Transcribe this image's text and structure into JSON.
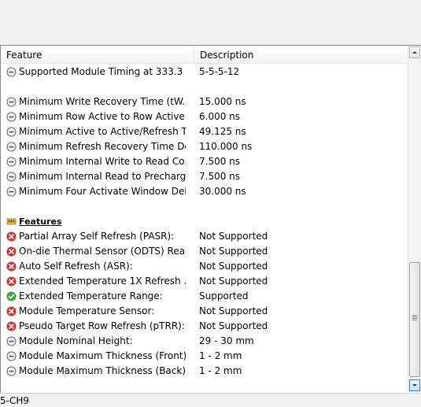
{
  "table": {
    "col_feature": "Feature",
    "col_description": "Description"
  },
  "rows": [
    {
      "icon": "info",
      "feature": "Supported Module Timing at 333.3 ...",
      "value": "5-5-5-12"
    },
    {
      "icon": "blank",
      "feature": "",
      "value": ""
    },
    {
      "icon": "info",
      "feature": "Minimum Write Recovery Time (tW...",
      "value": "15.000 ns"
    },
    {
      "icon": "info",
      "feature": "Minimum Row Active to Row Active...",
      "value": "6.000 ns"
    },
    {
      "icon": "info",
      "feature": "Minimum Active to Active/Refresh T...",
      "value": "49.125 ns"
    },
    {
      "icon": "info",
      "feature": "Minimum Refresh Recovery Time De...",
      "value": "110.000 ns"
    },
    {
      "icon": "info",
      "feature": "Minimum Internal Write to Read Co...",
      "value": "7.500 ns"
    },
    {
      "icon": "info",
      "feature": "Minimum Internal Read to Precharg...",
      "value": "7.500 ns"
    },
    {
      "icon": "info",
      "feature": "Minimum Four Activate Window Del...",
      "value": "30.000 ns"
    },
    {
      "icon": "blank",
      "feature": "",
      "value": ""
    },
    {
      "icon": "section",
      "feature": "Features",
      "value": ""
    },
    {
      "icon": "error",
      "feature": "Partial Array Self Refresh (PASR):",
      "value": "Not Supported"
    },
    {
      "icon": "error",
      "feature": "On-die Thermal Sensor (ODTS) Rea...",
      "value": "Not Supported"
    },
    {
      "icon": "error",
      "feature": "Auto Self Refresh (ASR):",
      "value": "Not Supported"
    },
    {
      "icon": "error",
      "feature": "Extended Temperature 1X Refresh ...",
      "value": "Not Supported"
    },
    {
      "icon": "ok",
      "feature": "Extended Temperature Range:",
      "value": "Supported"
    },
    {
      "icon": "error",
      "feature": "Module Temperature Sensor:",
      "value": "Not Supported"
    },
    {
      "icon": "error",
      "feature": "Pseudo Target Row Refresh (pTRR):",
      "value": "Not Supported"
    },
    {
      "icon": "info",
      "feature": "Module Nominal Height:",
      "value": "29 - 30 mm"
    },
    {
      "icon": "info",
      "feature": "Module Maximum Thickness (Front):",
      "value": "1 - 2 mm"
    },
    {
      "icon": "info",
      "feature": "Module Maximum Thickness (Back):",
      "value": "1 - 2 mm"
    }
  ],
  "icons": {
    "info": "info-circle-icon",
    "error": "error-x-icon",
    "ok": "check-ok-icon",
    "section": "memory-module-icon"
  },
  "colors": {
    "error": "#d8322e",
    "ok": "#3ea33a",
    "info": "#7d7d7d"
  },
  "statusbar": {
    "text": "5-CH9"
  }
}
